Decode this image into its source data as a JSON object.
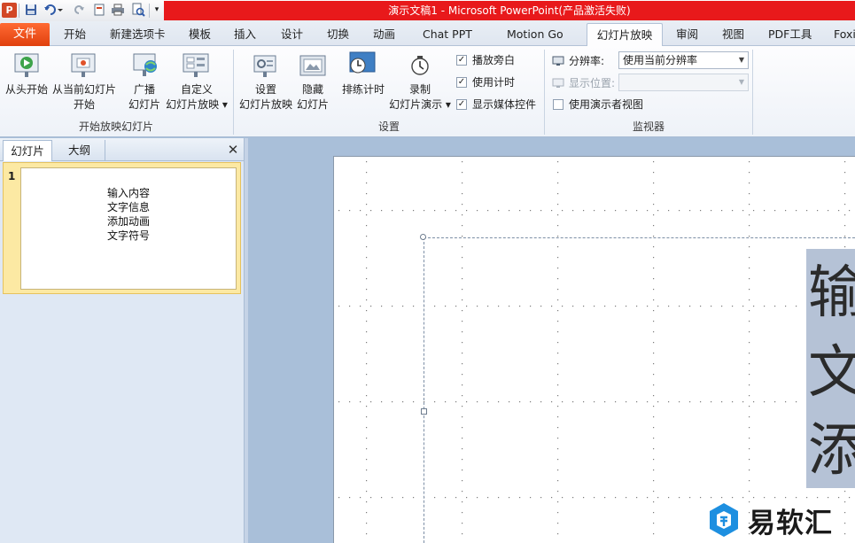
{
  "window": {
    "title": "演示文稿1 - Microsoft PowerPoint(产品激活失败)"
  },
  "tabs": [
    {
      "label": "文件"
    },
    {
      "label": "开始"
    },
    {
      "label": "新建选项卡"
    },
    {
      "label": "模板"
    },
    {
      "label": "插入"
    },
    {
      "label": "设计"
    },
    {
      "label": "切换"
    },
    {
      "label": "动画"
    },
    {
      "label": "Chat PPT"
    },
    {
      "label": "Motion Go"
    },
    {
      "label": "幻灯片放映"
    },
    {
      "label": "审阅"
    },
    {
      "label": "视图"
    },
    {
      "label": "PDF工具"
    },
    {
      "label": "Foxit"
    }
  ],
  "ribbon": {
    "group1": {
      "label": "开始放映幻灯片",
      "from_start": {
        "l1": "从头开始"
      },
      "from_current": {
        "l1": "从当前幻灯片",
        "l2": "开始"
      },
      "broadcast": {
        "l1": "广播",
        "l2": "幻灯片"
      },
      "custom": {
        "l1": "自定义",
        "l2": "幻灯片放映 ▾"
      }
    },
    "group2": {
      "label": "设置",
      "setup": {
        "l1": "设置",
        "l2": "幻灯片放映"
      },
      "hide": {
        "l1": "隐藏",
        "l2": "幻灯片"
      },
      "rehearse": {
        "l1": "排练计时"
      },
      "record": {
        "l1": "录制",
        "l2": "幻灯片演示 ▾"
      },
      "play_narration": {
        "label": "播放旁白",
        "checked": true
      },
      "use_timings": {
        "label": "使用计时",
        "checked": true
      },
      "show_media_controls": {
        "label": "显示媒体控件",
        "checked": true
      }
    },
    "group3": {
      "label": "监视器",
      "resolution_label": "分辨率:",
      "resolution_value": "使用当前分辨率",
      "display_label": "显示位置:",
      "display_value": "",
      "presenter_view": {
        "label": "使用演示者视图",
        "checked": false
      }
    }
  },
  "panel": {
    "tab_slides": "幻灯片",
    "tab_outline": "大纲",
    "close": "✕",
    "slide_number": "1",
    "thumb_lines": [
      "输入内容",
      "文字信息",
      "添加动画",
      "文字符号"
    ]
  },
  "slide": {
    "text_chars": [
      "输",
      "文",
      "添"
    ]
  },
  "watermark": {
    "text": "易软汇"
  },
  "colors": {
    "title_red": "#e8191b",
    "file_tab": "#e0400e",
    "selection": "#b5c2d6"
  }
}
